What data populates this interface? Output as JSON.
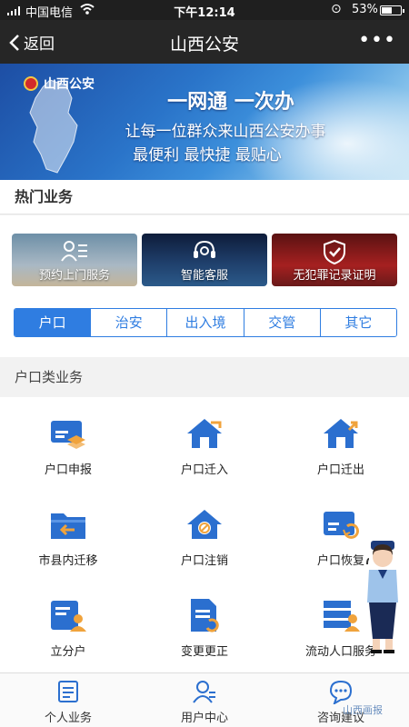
{
  "status": {
    "carrier": "中国电信",
    "time": "下午12:14",
    "battery": "53%",
    "battery_level": 0.53
  },
  "nav": {
    "back_label": "返回",
    "title": "山西公安",
    "more": "•••"
  },
  "banner": {
    "brand": "山西公安",
    "line1": "一网通 一次办",
    "line2": "让每一位群众来山西公安办事",
    "line3": "最便利 最快捷 最贴心"
  },
  "hot": {
    "title": "热门业务",
    "cards": [
      {
        "label": "预约上门服务",
        "icon": "user-card-icon"
      },
      {
        "label": "智能客服",
        "icon": "headset-icon"
      },
      {
        "label": "无犯罪记录证明",
        "icon": "shield-check-icon"
      }
    ],
    "tabs": [
      "户口",
      "治安",
      "出入境",
      "交管",
      "其它"
    ],
    "active_tab": "户口"
  },
  "category": {
    "title": "户口类业务",
    "items": [
      {
        "label": "户口申报",
        "icon": "id-card-icon"
      },
      {
        "label": "户口迁入",
        "icon": "house-in-icon"
      },
      {
        "label": "户口迁出",
        "icon": "house-out-icon"
      },
      {
        "label": "市县内迁移",
        "icon": "folder-move-icon"
      },
      {
        "label": "户口注销",
        "icon": "house-cancel-icon"
      },
      {
        "label": "户口恢复",
        "icon": "card-restore-icon"
      },
      {
        "label": "立分户",
        "icon": "split-household-icon"
      },
      {
        "label": "变更更正",
        "icon": "document-edit-icon"
      },
      {
        "label": "流动人口服务",
        "icon": "floating-population-icon"
      }
    ]
  },
  "tabbar": {
    "items": [
      {
        "label": "个人业务",
        "icon": "personal-business-icon"
      },
      {
        "label": "用户中心",
        "icon": "user-center-icon"
      },
      {
        "label": "咨询建议",
        "icon": "chat-icon"
      }
    ]
  },
  "watermark": "山西画报",
  "colors": {
    "accent": "#2f7de1",
    "icon_blue": "#2b6fcf",
    "icon_orange": "#f0a33c",
    "nav_bg": "#262626"
  }
}
